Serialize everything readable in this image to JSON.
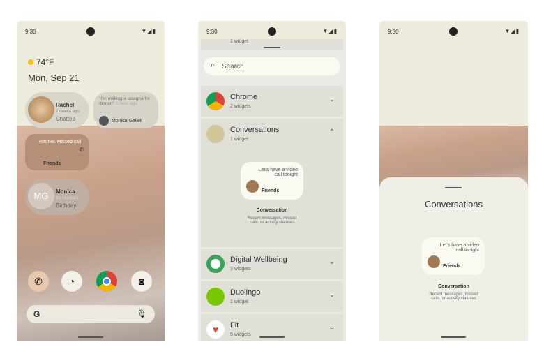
{
  "status": {
    "time": "9:30",
    "icons": "▼◢▮"
  },
  "home": {
    "weather": "74°F",
    "date": "Mon, Sep 21",
    "rachel": {
      "name": "Rachel",
      "time": "2 weeks ago",
      "status": "Chatted"
    },
    "message": {
      "text": "\"I'm making a lasagna for dinner!\"",
      "time": "1 hour ago",
      "sender": "Monica Geller"
    },
    "missed": {
      "text": "Rachel: Missed call",
      "group": "Friends"
    },
    "monica": {
      "initials": "MG",
      "name": "Monica",
      "sub": "It's Monica's",
      "status": "Birthday!"
    },
    "dock": [
      "phone-icon",
      "clock-icon",
      "chrome-icon",
      "camera-icon"
    ],
    "search_logo": "G"
  },
  "picker": {
    "search_placeholder": "Search",
    "top_partial": "1 widget",
    "items": [
      {
        "title": "Chrome",
        "sub": "2 widgets"
      },
      {
        "title": "Conversations",
        "sub": "1 widget"
      },
      {
        "title": "Digital Wellbeing",
        "sub": "3 widgets"
      },
      {
        "title": "Duolingo",
        "sub": "1 widget"
      },
      {
        "title": "Fit",
        "sub": "5 widgets"
      }
    ],
    "preview": {
      "message": "Let's have a video call tonight",
      "group": "Friends",
      "title": "Conversation",
      "desc": "Recent messages, missed calls, or activity statuses"
    }
  },
  "sheet": {
    "title": "Conversations",
    "preview": {
      "message": "Let's have a video call tonight",
      "group": "Friends",
      "title": "Conversation",
      "desc": "Recent messages, missed calls, or activity statuses"
    }
  }
}
